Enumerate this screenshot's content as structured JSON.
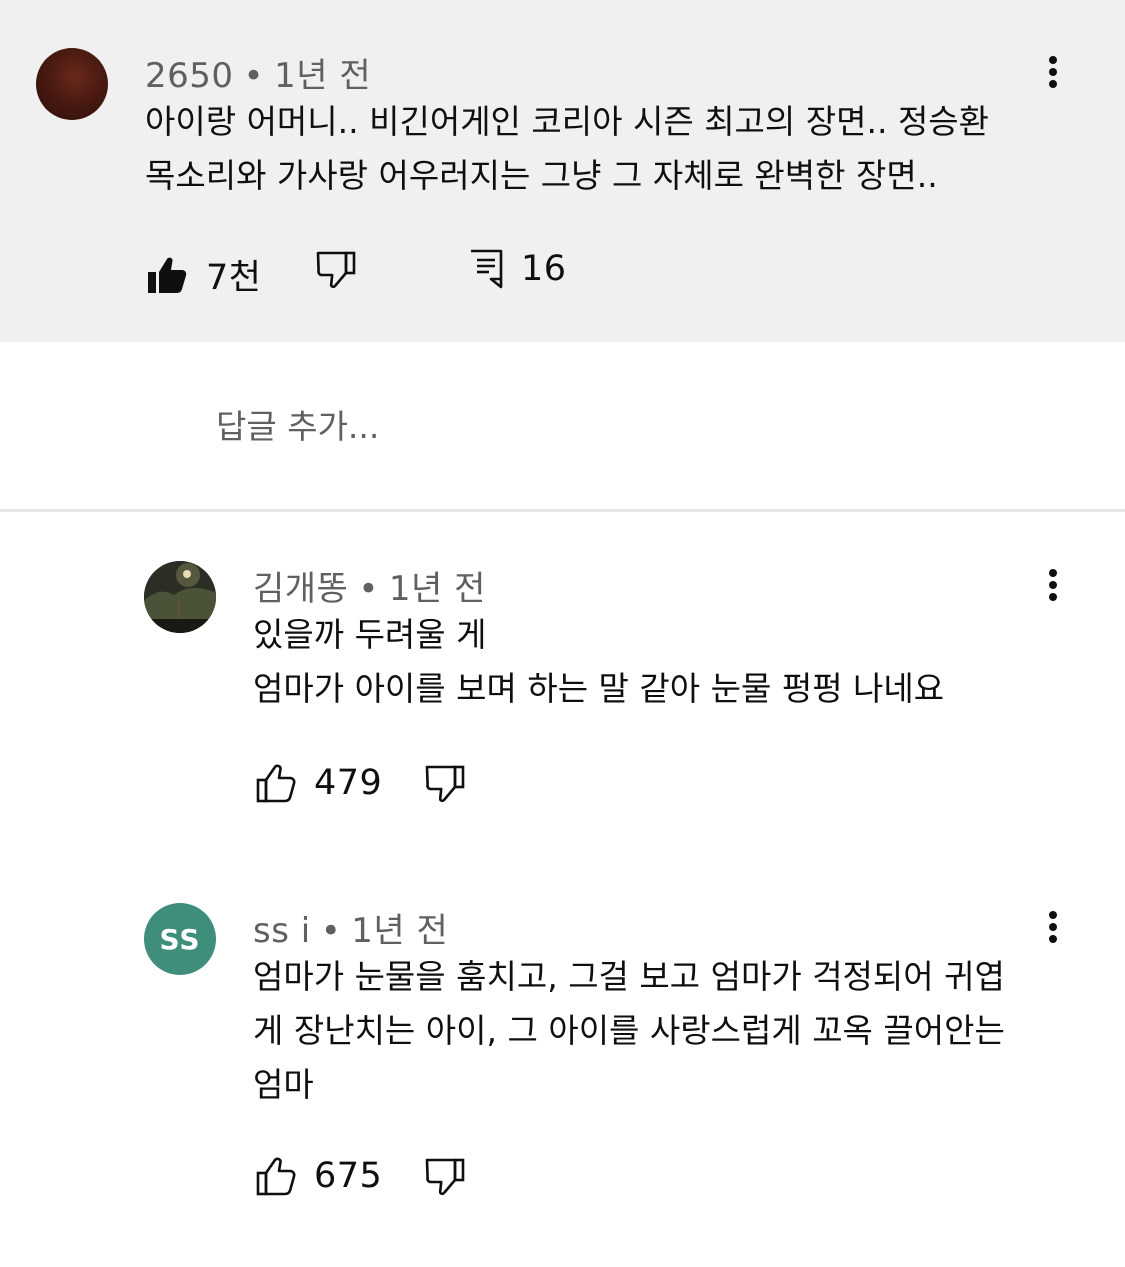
{
  "top_comment": {
    "author": "2650",
    "time": "1년 전",
    "text": "아이랑 어머니.. 비긴어게인 코리아 시즌 최고의 장면.. 정승환\n목소리와 가사랑 어우러지는 그냥 그 자체로 완벽한 장면..",
    "likes": "7천",
    "replies": "16",
    "avatar_color": "#5a1f14"
  },
  "reply_input": {
    "placeholder": "답글 추가..."
  },
  "replies": [
    {
      "author": "김개똥",
      "time": "1년 전",
      "text": "있을까 두려울 게\n엄마가 아이를 보며 하는 말 같아 눈물 펑펑 나네요",
      "likes": "479"
    },
    {
      "author": "ss i",
      "avatar_initials": "SS",
      "avatar_color": "#3f8d7b",
      "time": "1년 전",
      "text": "엄마가 눈물을 훔치고, 그걸 보고 엄마가 걱정되어 귀엽\n게 장난치는 아이, 그 아이를 사랑스럽게 꼬옥 끌어안는\n엄마",
      "likes": "675"
    }
  ],
  "colors": {
    "highlight_bg": "#f0f0f0",
    "meta_text": "#606060",
    "text": "#0f0f0f"
  }
}
